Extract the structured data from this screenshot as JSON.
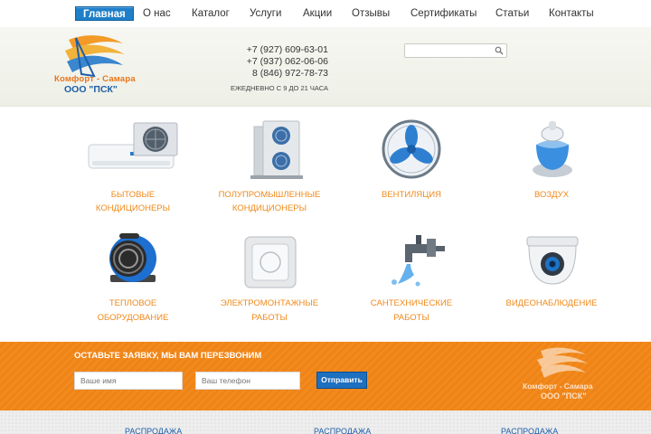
{
  "nav": {
    "items": [
      {
        "label": "Главная",
        "active": true
      },
      {
        "label": "О нас"
      },
      {
        "label": "Каталог"
      },
      {
        "label": "Услуги"
      },
      {
        "label": "Акции"
      },
      {
        "label": "Отзывы"
      },
      {
        "label": "Сертификаты"
      },
      {
        "label": "Статьи"
      },
      {
        "label": "Контакты"
      }
    ]
  },
  "header": {
    "logo_name": "Комфорт - Самара",
    "logo_org": "ООО \"ПСК\"",
    "phones": [
      "+7 (927) 609-63-01",
      "+7 (937) 062-06-06",
      "8 (846) 972-78-73"
    ],
    "hours": "ЕЖЕДНЕВНО С 9 ДО 21 ЧАСА",
    "search_placeholder": ""
  },
  "categories": [
    {
      "line1": "БЫТОВЫЕ",
      "line2": "КОНДИЦИОНЕРЫ",
      "icon": "air-conditioner-icon"
    },
    {
      "line1": "ПОЛУПРОМЫШЛЕННЫЕ",
      "line2": "КОНДИЦИОНЕРЫ",
      "icon": "outdoor-unit-icon"
    },
    {
      "line1": "ВЕНТИЛЯЦИЯ",
      "line2": "",
      "icon": "fan-icon"
    },
    {
      "line1": "ВОЗДУХ",
      "line2": "",
      "icon": "humidifier-icon"
    },
    {
      "line1": "ТЕПЛОВОЕ",
      "line2": "ОБОРУДОВАНИЕ",
      "icon": "heater-icon"
    },
    {
      "line1": "ЭЛЕКТРОМОНТАЖНЫЕ",
      "line2": "РАБОТЫ",
      "icon": "switch-icon"
    },
    {
      "line1": "САНТЕХНИЧЕСКИЕ",
      "line2": "РАБОТЫ",
      "icon": "faucet-icon"
    },
    {
      "line1": "ВИДЕОНАБЛЮДЕНИЕ",
      "line2": "",
      "icon": "camera-icon"
    }
  ],
  "callback": {
    "title": "ОСТАВЬТЕ ЗАЯВКУ, МЫ ВАМ ПЕРЕЗВОНИМ",
    "name_placeholder": "Ваше имя",
    "phone_placeholder": "Ваш телефон",
    "submit_label": "Отправить"
  },
  "bottom": {
    "sale_links": [
      "РАСПРОДАЖА",
      "РАСПРОДАЖА",
      "РАСПРОДАЖА"
    ]
  },
  "colors": {
    "accent_orange": "#ef8a1b",
    "brand_blue": "#1f7fc9"
  }
}
